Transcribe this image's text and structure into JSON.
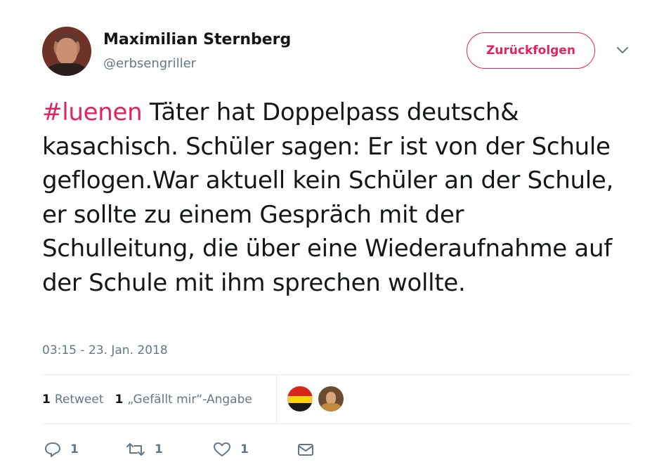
{
  "author": {
    "display_name": "Maximilian Sternberg",
    "handle": "@erbsengriller",
    "avatar_icon": "user-avatar"
  },
  "follow_button": {
    "label": "Zurückfolgen"
  },
  "menu": {
    "icon": "chevron-down-icon"
  },
  "tweet": {
    "hashtag": "#luenen",
    "text": " Täter hat Doppelpass deutsch& kasachisch. Schüler sagen: Er ist von der Schule geflogen.War aktuell kein Schüler an der Schule, er sollte zu einem Gespräch mit der Schulleitung, die über eine Wiederaufnahme auf der Schule mit ihm sprechen wollte.",
    "timestamp": "03:15 - 23. Jan. 2018"
  },
  "stats": {
    "retweets_count": "1",
    "retweets_label": "Retweet",
    "likes_count": "1",
    "likes_label": "„Gefällt mir“-Angabe"
  },
  "actions": {
    "reply_count": "1",
    "retweet_count": "1",
    "like_count": "1"
  },
  "colors": {
    "accent": "#e0245e",
    "text": "#14171a",
    "secondary": "#657786",
    "divider": "#e6ecf0"
  }
}
